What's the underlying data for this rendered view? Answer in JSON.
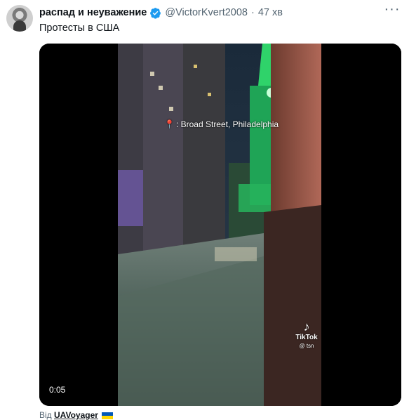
{
  "tweet": {
    "author_name": "распад и неуважение",
    "handle": "@VictorKvert2008",
    "separator": "·",
    "time": "47 хв",
    "more_label": "···",
    "text": "Протесты в США"
  },
  "video": {
    "location_label": ": Broad Street, Philadelphia",
    "watermark_brand": "TikTok",
    "watermark_user": "@ tsn",
    "duration": "0:05"
  },
  "attribution": {
    "prefix": "Від",
    "user": "UAVoyager"
  },
  "colors": {
    "verified": "#1d9bf0",
    "flag_blue": "#0057b7",
    "flag_yellow": "#ffd700",
    "tower_green": "#2fd36a"
  },
  "icons": {
    "verified": "verified-badge-icon",
    "more": "more-icon",
    "pin": "location-pin-icon",
    "tiktok": "tiktok-logo-icon"
  }
}
